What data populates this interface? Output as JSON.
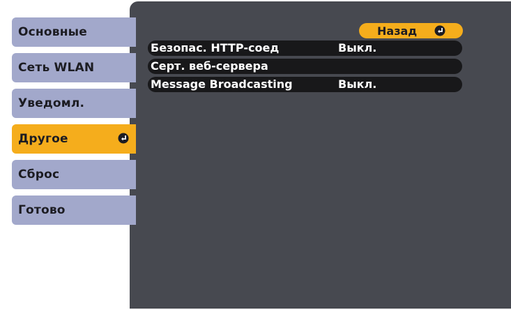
{
  "sidebar": {
    "items": [
      {
        "label": "Основные"
      },
      {
        "label": "Сеть WLAN"
      },
      {
        "label": "Уведомл."
      },
      {
        "label": "Другое",
        "selected": true
      },
      {
        "label": "Сброс"
      },
      {
        "label": "Готово"
      }
    ]
  },
  "main": {
    "back_label": "Назад",
    "rows": [
      {
        "label": "Безопас. HTTP-соед",
        "value": "Выкл."
      },
      {
        "label": "Серт. веб-сервера",
        "value": ""
      },
      {
        "label": "Message Broadcasting",
        "value": "Выкл."
      }
    ]
  },
  "icons": {
    "enter": "enter-icon"
  },
  "colors": {
    "tab": "#a2a8cb",
    "highlight": "#f5ad1c",
    "panel": "#474950",
    "row": "#18181a"
  }
}
